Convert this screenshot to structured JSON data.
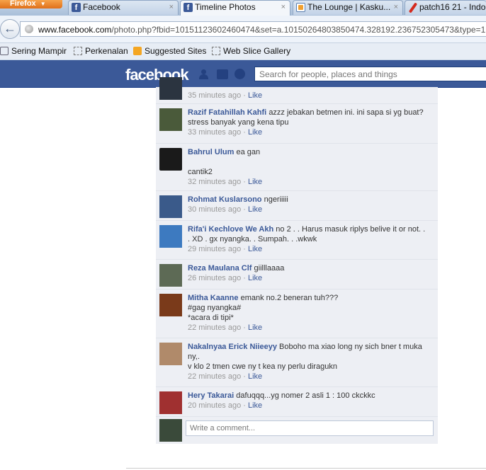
{
  "browser": {
    "app_button": "Firefox",
    "tabs": [
      {
        "title": "Facebook",
        "icon": "facebook-icon"
      },
      {
        "title": "Timeline Photos",
        "icon": "facebook-icon"
      },
      {
        "title": "The Lounge | Kasku...",
        "icon": "kaskus-icon"
      },
      {
        "title": "patch16 21 - Indo",
        "icon": "red-pin-icon"
      }
    ],
    "close_glyph": "×",
    "url_host": "www.facebook.com",
    "url_path": "/photo.php?fbid=10151123602460474&set=a.10150264803850474.328192.236752305473&type=1",
    "bookmarks": [
      "Sering Mampir",
      "Perkenalan",
      "Suggested Sites",
      "Web Slice Gallery"
    ]
  },
  "facebook": {
    "logo": "facebook",
    "search_placeholder": "Search for people, places and things",
    "brand_color": "#3b5998"
  },
  "comments": [
    {
      "name": "",
      "text": "",
      "time": "35 minutes ago",
      "like": "Like",
      "avatar": "#2b3440"
    },
    {
      "name": "Razif Fatahillah Kahfi",
      "text": "azzz jebakan betmen ini. ini sapa si yg buat? stress banyak yang kena tipu",
      "time": "33 minutes ago",
      "like": "Like",
      "avatar": "#4a5a3a"
    },
    {
      "name": "Bahrul Ulum",
      "text": "ea gan\n\ncantik2",
      "time": "32 minutes ago",
      "like": "Like",
      "avatar": "#1a1a1a"
    },
    {
      "name": "Rohmat Kuslarsono",
      "text": "ngeriiiii",
      "time": "30 minutes ago",
      "like": "Like",
      "avatar": "#3a5a8a"
    },
    {
      "name": "Rifa'i Kechlove We Akh",
      "text": "no 2 . . Harus masuk riplys belive it or not. . . XD . gx nyangka. . Sumpah. . .wkwk",
      "time": "29 minutes ago",
      "like": "Like",
      "avatar": "#3d7ac0"
    },
    {
      "name": "Reza Maulana Clf",
      "text": "giilllaaaa",
      "time": "26 minutes ago",
      "like": "Like",
      "avatar": "#5d6a55"
    },
    {
      "name": "Mitha Kaanne",
      "text": "emank no.2 beneran tuh???\n#gag nyangka#\n*acara di tipi*",
      "time": "22 minutes ago",
      "like": "Like",
      "avatar": "#7a3a1a"
    },
    {
      "name": "Nakalnyaa Erick Niieeyy",
      "text": "Boboho ma xiao long ny sich bner t muka ny,.\nv klo 2 tmen cwe ny t kea ny perlu diragukn",
      "time": "22 minutes ago",
      "like": "Like",
      "avatar": "#b08a6a"
    },
    {
      "name": "Hery Takarai",
      "text": "dafuqqq...yg nomer 2 asli 1 : 100 ckckkc",
      "time": "20 minutes ago",
      "like": "Like",
      "avatar": "#a03030"
    }
  ],
  "compose": {
    "placeholder": "Write a comment...",
    "avatar": "#3a4a3a"
  }
}
